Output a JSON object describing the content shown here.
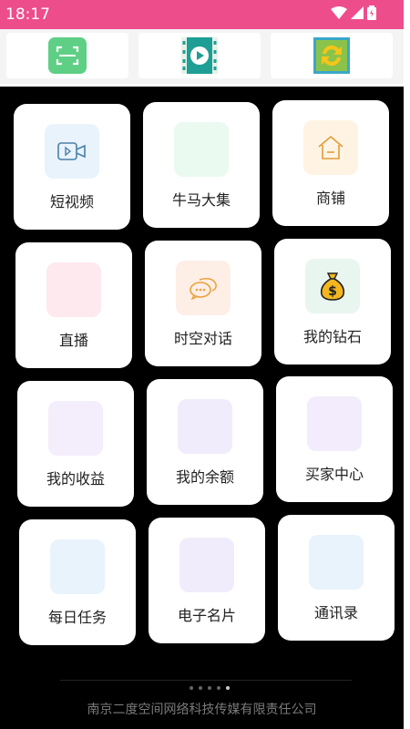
{
  "status": {
    "time": "18:17"
  },
  "toolbar": {
    "buttons": [
      {
        "icon": "scan-icon",
        "color": "#5fcf86"
      },
      {
        "icon": "video-play-icon",
        "color": "#26a69a"
      },
      {
        "icon": "refresh-icon",
        "color": "#4caf50"
      }
    ]
  },
  "grid": {
    "tiles": [
      {
        "label": "短视频",
        "icon": "video-icon",
        "bg": "#e8f3fc"
      },
      {
        "label": "牛马大集",
        "icon": "",
        "bg": "#eafaf0"
      },
      {
        "label": "商铺",
        "icon": "home-icon",
        "bg": "#fff4e3"
      },
      {
        "label": "直播",
        "icon": "",
        "bg": "#fde9ee"
      },
      {
        "label": "时空对话",
        "icon": "chat-icon",
        "bg": "#fdeee6"
      },
      {
        "label": "我的钻石",
        "icon": "money-bag-icon",
        "bg": "#e8f6ef"
      },
      {
        "label": "我的收益",
        "icon": "",
        "bg": "#f3edfc"
      },
      {
        "label": "我的余额",
        "icon": "",
        "bg": "#f1ecfc"
      },
      {
        "label": "买家中心",
        "icon": "",
        "bg": "#f2ecfc"
      },
      {
        "label": "每日任务",
        "icon": "",
        "bg": "#e8f3fc"
      },
      {
        "label": "电子名片",
        "icon": "",
        "bg": "#f1ecfc"
      },
      {
        "label": "通讯录",
        "icon": "",
        "bg": "#e8f3fc"
      }
    ]
  },
  "pager": {
    "count": 5,
    "active": 4
  },
  "footer": {
    "text": "南京二度空间网络科技传媒有限责任公司"
  }
}
